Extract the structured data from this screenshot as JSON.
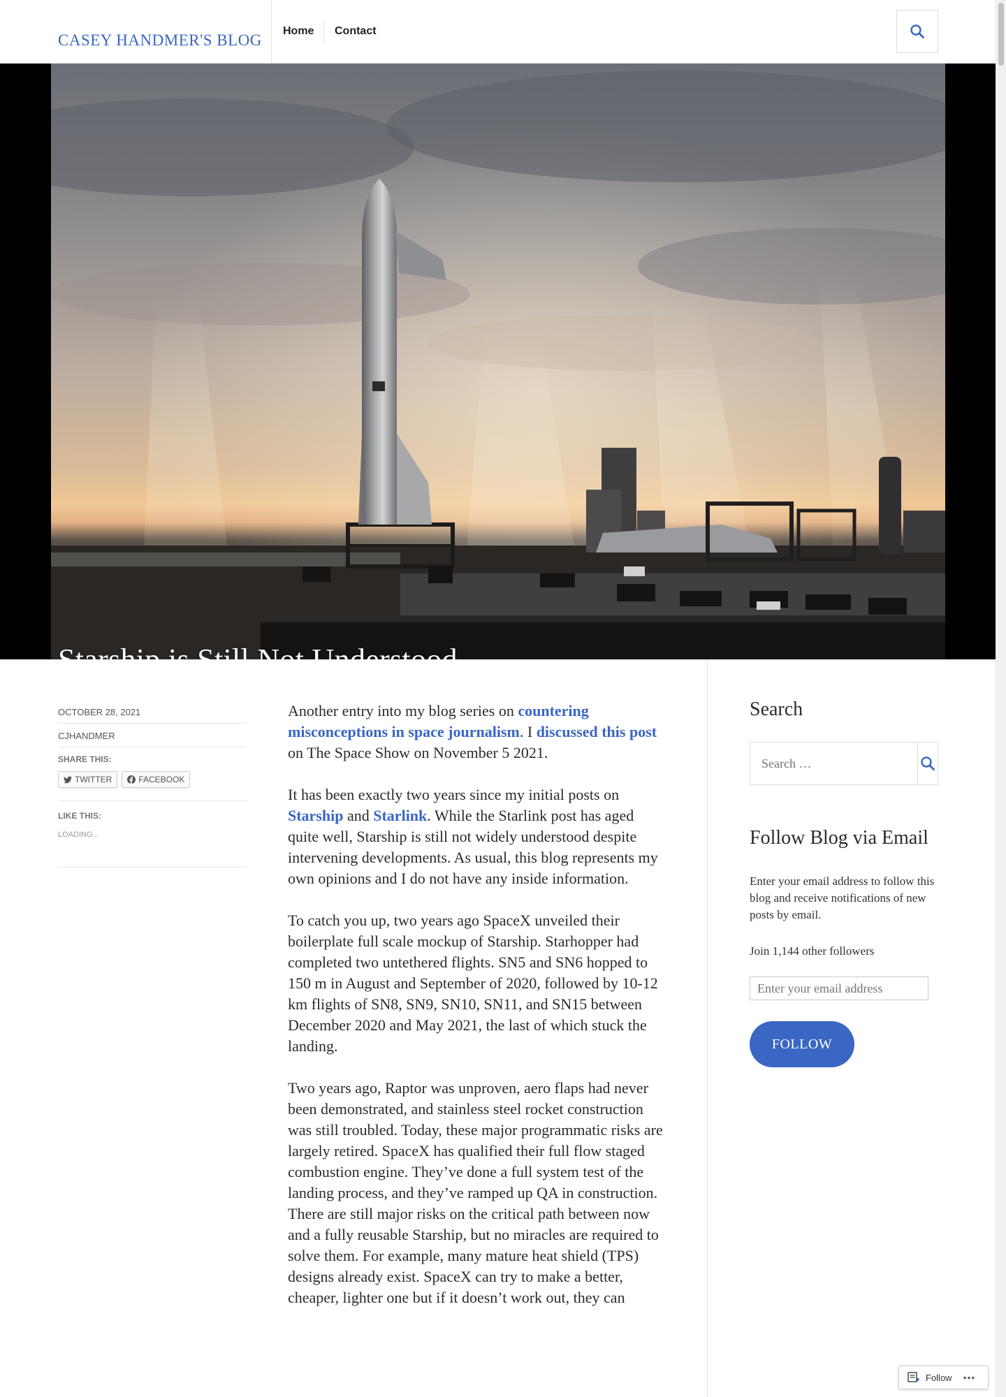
{
  "site": {
    "title": "CASEY HANDMER'S BLOG"
  },
  "nav": {
    "home": "Home",
    "contact": "Contact",
    "search_icon": "search-icon"
  },
  "post": {
    "title": "Starship is Still Not Understood",
    "date": "OCTOBER 28, 2021",
    "author": "CJHANDMER",
    "share_label": "SHARE THIS:",
    "share_twitter": "TWITTER",
    "share_facebook": "FACEBOOK",
    "like_label": "LIKE THIS:",
    "loading": "LOADING..."
  },
  "article": {
    "p1_a": "Another entry into my blog series on ",
    "p1_link1": "countering misconceptions in space journalism",
    "p1_b": ". I ",
    "p1_link2": "discussed this post",
    "p1_c": " on The Space Show on November 5 2021.",
    "p2_a": "It has been exactly two years since my initial posts on ",
    "p2_link1": "Starship",
    "p2_b": " and ",
    "p2_link2": "Starlink",
    "p2_c": ". While the Starlink post has aged quite well, Starship is still not widely understood despite intervening developments. As usual, this blog represents my own opinions and I do not have any inside information.",
    "p3": "To catch you up, two years ago SpaceX unveiled their boilerplate full scale mockup of Starship. Starhopper had completed two untethered flights. SN5 and SN6 hopped to 150 m in August and September of 2020, followed by 10-12 km flights of SN8, SN9, SN10, SN11, and SN15 between December 2020 and May 2021, the last of which stuck the landing.",
    "p4": "Two years ago, Raptor was unproven, aero flaps had never been demonstrated, and stainless steel rocket construction was still troubled. Today, these major programmatic risks are largely retired. SpaceX has qualified their full flow staged combustion engine. They’ve done a full system test of the landing process, and they’ve ramped up QA in construction. There are still major risks on the critical path between now and a fully reusable Starship, but no miracles are required to solve them. For example, many mature heat shield (TPS) designs already exist. SpaceX can try to make a better, cheaper, lighter one but if it doesn’t work out, they can"
  },
  "sidebar": {
    "search_title": "Search",
    "search_placeholder": "Search …",
    "follow_title": "Follow Blog via Email",
    "follow_desc": "Enter your email address to follow this blog and receive notifications of new posts by email.",
    "followers": "Join 1,144 other followers",
    "email_placeholder": "Enter your email address",
    "follow_button": "FOLLOW"
  },
  "floating": {
    "follow_label": "Follow",
    "more": "•••"
  },
  "colors": {
    "accent": "#3a66c4",
    "text": "#2b2b2b"
  }
}
